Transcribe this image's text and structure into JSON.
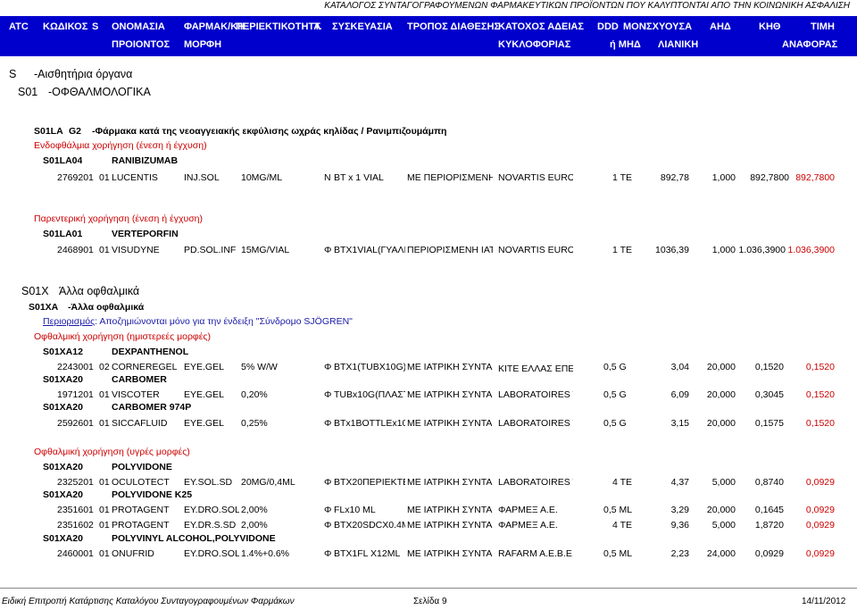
{
  "doc_title": "ΚΑΤΑΛΟΓΟΣ ΣΥΝΤΑΓΟΓΡΑΦΟΥΜΕΝΩΝ ΦΑΡΜΑΚΕΥΤΙΚΩΝ ΠΡΟΪΟΝΤΩΝ ΠΟΥ ΚΑΛΥΠΤΟΝΤΑΙ ΑΠΟ ΤΗΝ ΚΟΙΝΩΝΙΚΗ ΑΣΦΑΛΙΣΗ",
  "header": {
    "atc": "ATC",
    "code": "ΚΩΔΙΚΟΣ",
    "s": "S",
    "product": "ΠΡΟΙΟΝΤΟΣ",
    "name": "ΟΝΟΜΑΣΙΑ",
    "form1": "ΦΑΡΜΑΚ/ΚΗ",
    "form2": "ΜΟΡΦΗ",
    "content": "ΠΕΡΙΕΚΤΙΚΟΤΗΤΑ",
    "t": "Τ.",
    "pack": "ΣΥΣΚΕΥΑΣΙΑ",
    "dispense": "ΤΡΟΠΟΣ ΔΙΑΘΕΣΗΣ",
    "holder1": "ΚΑΤΟΧΟΣ ΑΔΕΙΑΣ",
    "holder2": "ΚΥΚΛΟΦΟΡΙΑΣ",
    "ddd": "DDD",
    "mon1": "ΜΟΝ",
    "mon2": "ή ΜΗΔ",
    "valid": "ΙΣΧΥΟΥΣΑ",
    "retail": "ΛΙΑΝΙΚΗ",
    "ahd": "ΑΗΔ",
    "khth": "ΚΗΘ",
    "price1": "ΤΙΜΗ",
    "price2": "ΑΝΑΦΟΡΑΣ"
  },
  "sec_s": {
    "code": "S",
    "label": "-Αισθητήρια όργανα"
  },
  "sec_s01": {
    "code": "S01",
    "label": "-ΟΦΘΑΛΜΟΛΟΓΙΚΑ"
  },
  "sec_s01la": {
    "code": "S01LA",
    "g": "G2",
    "label": "-Φάρμακα κατά της νεοαγγειακής εκφύλισης ωχράς κηλίδας / Ρανιμπιζουμάμπη"
  },
  "route1": "Ενδοφθάλμια χορήγηση (ένεση ή έγχυση)",
  "atc_s01la04": {
    "code": "S01LA04",
    "name": "RANIBIZUMAB"
  },
  "row1": {
    "code": "2769201",
    "s": "01",
    "name": "LUCENTIS",
    "form": "INJ.SOL",
    "content": "10MG/ML",
    "t": "N",
    "pack": "BT x 1 VIAL",
    "dispense": "ΜΕ ΠΕΡΙΟΡΙΣΜΕΝΗ",
    "holder": "NOVARTIS EURO",
    "ddd": "1 TE",
    "retail": "892,78",
    "ahd": "1,000",
    "khth": "892,7800",
    "ref": "892,7800"
  },
  "route2": "Παρεντερική χορήγηση (ένεση ή έγχυση)",
  "atc_s01la01": {
    "code": "S01LA01",
    "name": "VERTEPORFIN"
  },
  "row2": {
    "code": "2468901",
    "s": "01",
    "name": "VISUDYNE",
    "form": "PD.SOL.INF",
    "content": "15MG/VIAL",
    "t": "Φ",
    "pack": "BTX1VIAL(ΓΥΑΛΙΝ",
    "dispense": "ΠΕΡΙΟΡΙΣΜΕΝΗ ΙΑΤ",
    "holder": "NOVARTIS EURO",
    "ddd": "1 TE",
    "retail": "1036,39",
    "ahd": "1,000",
    "khth": "1.036,3900",
    "ref": "1.036,3900"
  },
  "sec_s01x": {
    "code": "S01X",
    "label": "Άλλα οφθαλμικά"
  },
  "sec_s01xa": {
    "code": "S01XA",
    "label": "-Άλλα οφθαλμικά"
  },
  "restriction": {
    "label": "Περιορισμός",
    "text": ": Αποζημιώνονται μόνο για την ένδειξη \"Σύνδρομο SJÖGREN\""
  },
  "route3": "Οφθαλμική χορήγηση (ημιστερεές μορφές)",
  "atc_dexpanthenol": {
    "code": "S01XA12",
    "name": "DEXPANTHENOL"
  },
  "row3": {
    "code": "2243001",
    "s": "02",
    "name": "CORNEREGEL",
    "form": "EYE.GEL",
    "content": "5% W/W",
    "t": "Φ",
    "pack": "BTX1(TUBX10G)",
    "dispense": "ΜΕ ΙΑΤΡΙΚΗ ΣΥΝΤΑΓ",
    "holder": "ΚΙΤΕ ΕΛΛΑΣ ΕΠΕ",
    "ddd": "0,5 G",
    "retail": "3,04",
    "ahd": "20,000",
    "khth": "0,1520",
    "ref": "0,1520"
  },
  "atc_carbomer": {
    "code": "S01XA20",
    "name": "CARBOMER"
  },
  "row4": {
    "code": "1971201",
    "s": "01",
    "name": "VISCOTER",
    "form": "EYE.GEL",
    "content": "0,20%",
    "t": "Φ",
    "pack": "TUBx10G(ΠΛΑΣΤ",
    "dispense": "ΜΕ ΙΑΤΡΙΚΗ ΣΥΝΤΑΓ",
    "holder": "LABORATOIRES T",
    "ddd": "0,5 G",
    "retail": "6,09",
    "ahd": "20,000",
    "khth": "0,3045",
    "ref": "0,1520"
  },
  "atc_carbomer974": {
    "code": "S01XA20",
    "name": "CARBOMER 974P"
  },
  "row5": {
    "code": "2592601",
    "s": "01",
    "name": "SICCAFLUID",
    "form": "EYE.GEL",
    "content": "0,25%",
    "t": "Φ",
    "pack": "BTx1BOTTLEx10",
    "dispense": "ΜΕ ΙΑΤΡΙΚΗ ΣΥΝΤΑΓ",
    "holder": "LABORATOIRES T",
    "ddd": "0,5 G",
    "retail": "3,15",
    "ahd": "20,000",
    "khth": "0,1575",
    "ref": "0,1520"
  },
  "route4": "Οφθαλμική χορήγηση (υγρές μορφές)",
  "atc_polyvidone": {
    "code": "S01XA20",
    "name": "POLYVIDONE"
  },
  "row6": {
    "code": "2325201",
    "s": "01",
    "name": "OCULOTECT",
    "form": "EY.SOL.SD",
    "content": "20MG/0,4ML",
    "t": "Φ",
    "pack": "BTX20ΠΕΡΙΕΚΤΕ",
    "dispense": "ΜΕ ΙΑΤΡΙΚΗ ΣΥΝΤΑΓ",
    "holder": "LABORATOIRES T",
    "ddd": "4 TE",
    "retail": "4,37",
    "ahd": "5,000",
    "khth": "0,8740",
    "ref": "0,0929"
  },
  "atc_polyvidone_k25": {
    "code": "S01XA20",
    "name": "POLYVIDONE K25"
  },
  "row7": {
    "code": "2351601",
    "s": "01",
    "name": "PROTAGENT",
    "form": "EY.DRO.SOL",
    "content": "2,00%",
    "t": "Φ",
    "pack": "FLx10 ML",
    "dispense": "ΜΕ ΙΑΤΡΙΚΗ ΣΥΝΤΑΓ",
    "holder": "ΦΑΡΜΕΞ Α.Ε.",
    "ddd": "0,5 ML",
    "retail": "3,29",
    "ahd": "20,000",
    "khth": "0,1645",
    "ref": "0,0929"
  },
  "row8": {
    "code": "2351602",
    "s": "01",
    "name": "PROTAGENT",
    "form": "EY.DR.S.SD",
    "content": "2,00%",
    "t": "Φ",
    "pack": "BTX20SDCX0.4M",
    "dispense": "ΜΕ ΙΑΤΡΙΚΗ ΣΥΝΤΑΓ",
    "holder": "ΦΑΡΜΕΞ Α.Ε.",
    "ddd": "4 TE",
    "retail": "9,36",
    "ahd": "5,000",
    "khth": "1,8720",
    "ref": "0,0929"
  },
  "atc_pva": {
    "code": "S01XA20",
    "name": "POLYVINYL ALCOHOL,POLYVIDONE"
  },
  "row9": {
    "code": "2460001",
    "s": "01",
    "name": "ONUFRID",
    "form": "EY.DRO.SOL",
    "content": "1.4%+0.6%",
    "t": "Φ",
    "pack": "BTX1FL X12ML",
    "dispense": "ΜΕ ΙΑΤΡΙΚΗ ΣΥΝΤΑΓ",
    "holder": "RAFARM A.E.B.E.",
    "ddd": "0,5 ML",
    "retail": "2,23",
    "ahd": "24,000",
    "khth": "0,0929",
    "ref": "0,0929"
  },
  "footer": {
    "left": "Ειδική Επιτροπή Κατάρτισης Καταλόγου Συνταγογραφουμένων Φαρμάκων",
    "page": "Σελίδα 9",
    "date": "14/11/2012"
  },
  "colors": {
    "header_bg": "#0000cc",
    "header_text": "#ffffff",
    "red_text": "#cc0000",
    "link_blue": "#1a1aaa"
  }
}
